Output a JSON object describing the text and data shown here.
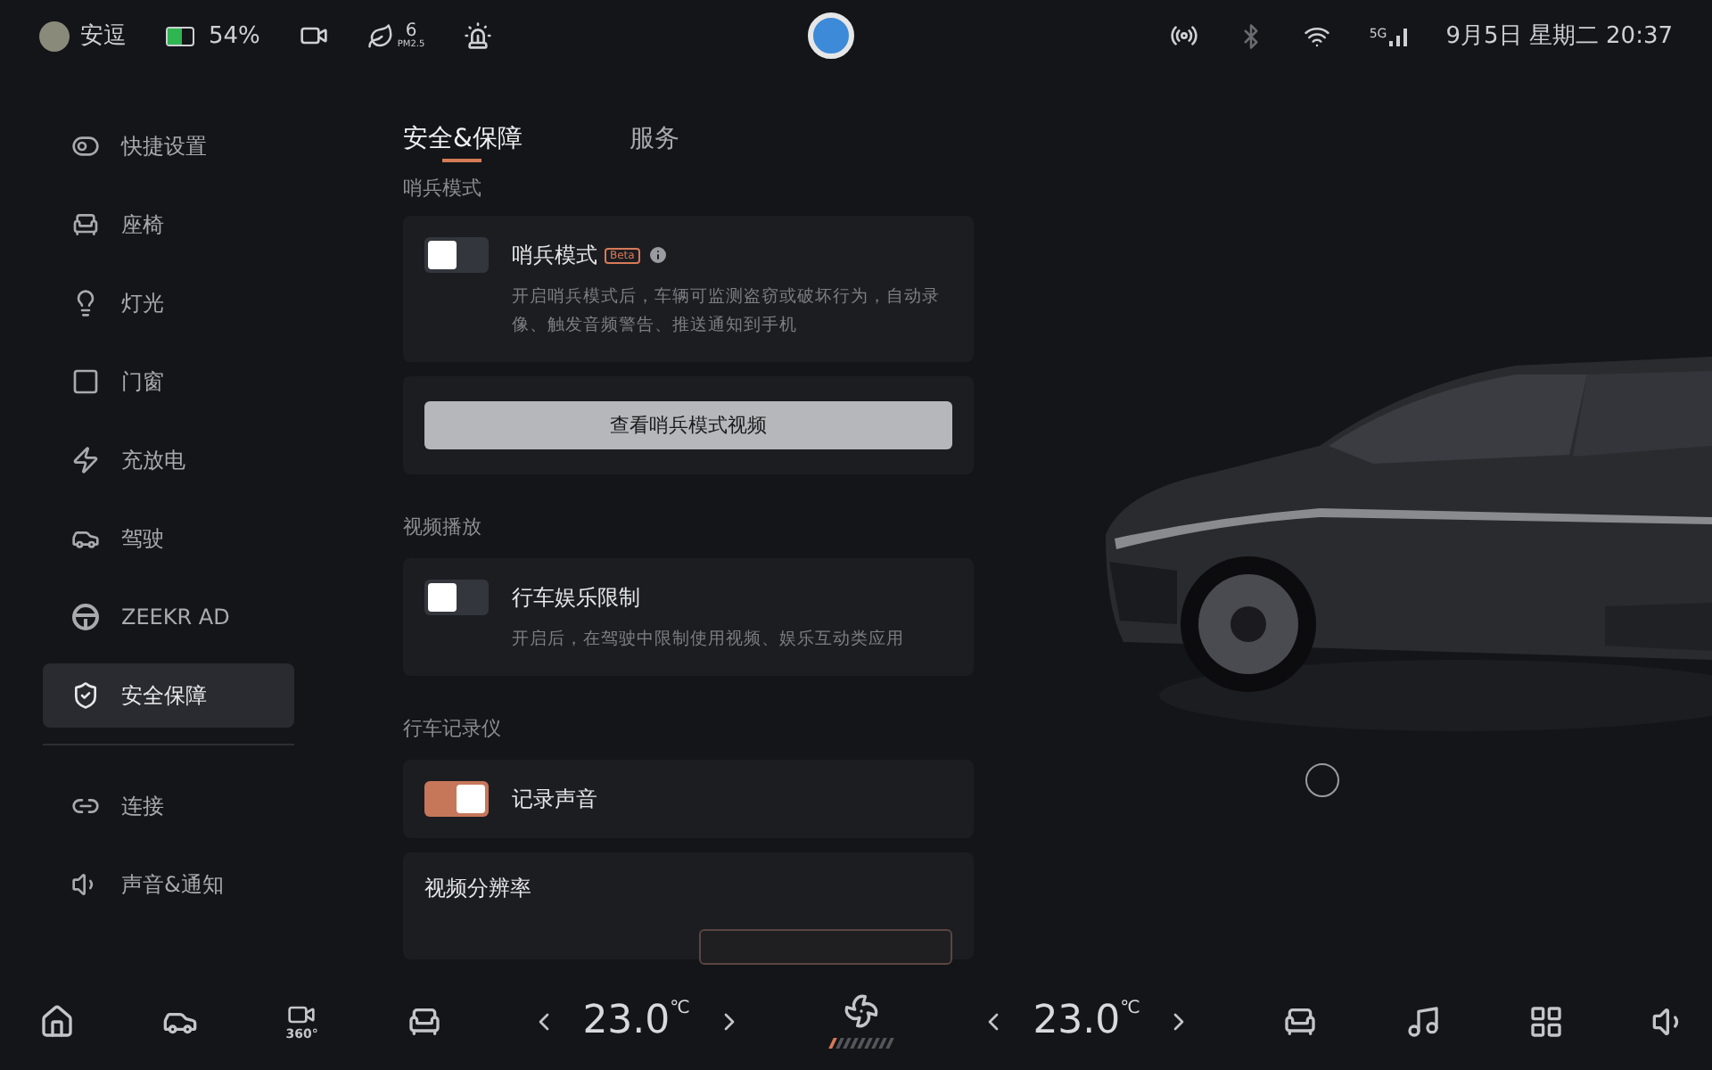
{
  "status_bar": {
    "user": "安逗",
    "battery": {
      "level": 0.54,
      "reading": "54%"
    },
    "pm25": {
      "value": "6",
      "label": "PM2.5"
    },
    "datetime": "9月5日 星期二 20:37",
    "signal_label": "5G"
  },
  "sidebar": {
    "items": [
      {
        "label": "快捷设置",
        "selected": false,
        "separator_before": false
      },
      {
        "label": "座椅",
        "selected": false,
        "separator_before": false
      },
      {
        "label": "灯光",
        "selected": false,
        "separator_before": false
      },
      {
        "label": "门窗",
        "selected": false,
        "separator_before": false
      },
      {
        "label": "充放电",
        "selected": false,
        "separator_before": false
      },
      {
        "label": "驾驶",
        "selected": false,
        "separator_before": false
      },
      {
        "label": "ZEEKR AD",
        "selected": false,
        "separator_before": false
      },
      {
        "label": "安全保障",
        "selected": true,
        "separator_before": false
      },
      {
        "label": "连接",
        "selected": false,
        "separator_before": true
      },
      {
        "label": "声音&通知",
        "selected": false,
        "separator_before": false
      }
    ]
  },
  "tabs": [
    {
      "label": "安全&保障",
      "selected": true
    },
    {
      "label": "服务",
      "selected": false
    }
  ],
  "sections": [
    {
      "heading": "哨兵模式",
      "cards": [
        {
          "kind": "toggle",
          "title": "哨兵模式",
          "badge": "Beta",
          "info": true,
          "on": false,
          "description": "开启哨兵模式后，车辆可监测盗窃或破坏行为，自动录像、触发音频警告、推送通知到手机"
        },
        {
          "kind": "button",
          "label": "查看哨兵模式视频"
        }
      ]
    },
    {
      "heading": "视频播放",
      "cards": [
        {
          "kind": "toggle",
          "title": "行车娱乐限制",
          "on": false,
          "description": "开启后，在驾驶中限制使用视频、娱乐互动类应用"
        }
      ]
    },
    {
      "heading": "行车记录仪",
      "cards": [
        {
          "kind": "toggle",
          "title": "记录声音",
          "on": true
        },
        {
          "kind": "segments",
          "title": "视频分辨率"
        }
      ]
    }
  ],
  "climate": {
    "left_temp": "23.0",
    "right_temp": "23.0",
    "unit": "℃",
    "fan": {
      "level": 0.11
    }
  },
  "dock": {
    "camera_label": "360°"
  }
}
